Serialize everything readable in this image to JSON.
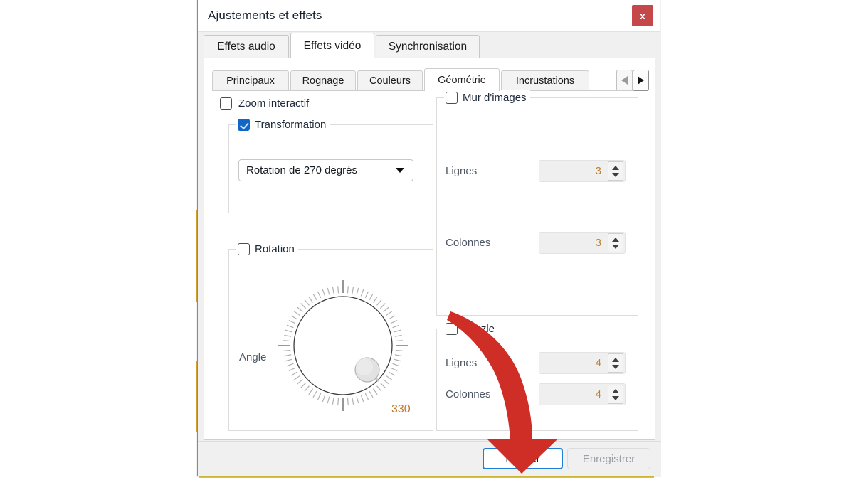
{
  "window": {
    "title": "Ajustements et effets",
    "close_label": "x",
    "close_icon": "close-icon",
    "close_color": "#c4474a"
  },
  "outer_tabs": [
    {
      "label": "Effets audio",
      "selected": false
    },
    {
      "label": "Effets vidéo",
      "selected": true
    },
    {
      "label": "Synchronisation",
      "selected": false
    }
  ],
  "inner_tabs": [
    {
      "label": "Principaux",
      "selected": false
    },
    {
      "label": "Rognage",
      "selected": false
    },
    {
      "label": "Couleurs",
      "selected": false
    },
    {
      "label": "Géométrie",
      "selected": true
    },
    {
      "label": "Incrustations",
      "selected": false
    }
  ],
  "tab_scroll": {
    "prev_icon": "chevron-left-icon",
    "next_icon": "chevron-right-icon",
    "prev_enabled": false,
    "next_enabled": true
  },
  "left_pane": {
    "zoom_interactif": {
      "label": "Zoom interactif",
      "checked": false
    },
    "transformation": {
      "label": "Transformation",
      "checked": true,
      "combo_value": "Rotation de 270 degrés",
      "combo_icon": "chevron-down-icon"
    },
    "rotation": {
      "label": "Rotation",
      "checked": false,
      "angle_label": "Angle",
      "angle_value": "330"
    }
  },
  "right_pane": {
    "mur_dimages": {
      "label": "Mur d'images",
      "checked": false,
      "rows_label": "Lignes",
      "rows_value": "3",
      "cols_label": "Colonnes",
      "cols_value": "3"
    },
    "puzzle": {
      "label": "Puzzle",
      "checked": false,
      "rows_label": "Lignes",
      "rows_value": "4",
      "cols_label": "Colonnes",
      "cols_value": "4"
    }
  },
  "footer": {
    "close_label": "Fermer",
    "save_label": "Enregistrer",
    "focus_color": "#1e7fd4"
  },
  "annotation": {
    "arrow_icon": "curved-down-arrow-icon",
    "color": "#cf2e27",
    "points_to": "Fermer"
  }
}
